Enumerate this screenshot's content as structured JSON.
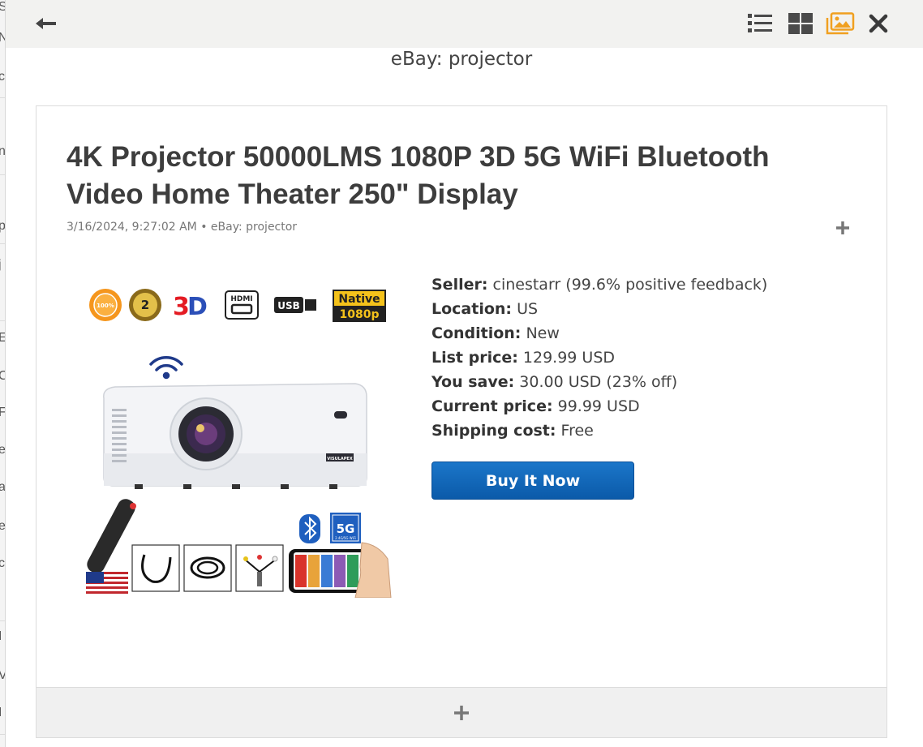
{
  "background": {
    "letters": [
      "S",
      "N",
      "c",
      "",
      "n",
      "",
      "p",
      "j",
      "E",
      "C",
      "F",
      "e",
      "a",
      "e",
      "c",
      "I",
      "V",
      "I"
    ]
  },
  "toolbar": {
    "back_icon": "arrow-left-icon",
    "list_view_icon": "list-view-icon",
    "grid_view_icon": "grid-view-icon",
    "image_view_icon": "image-view-icon",
    "close_icon": "close-icon",
    "active_color": "#f0a020",
    "icon_color": "#444444"
  },
  "feed_title": "eBay: projector",
  "item": {
    "title": "4K Projector 50000LMS 1080P 3D 5G WiFi Bluetooth Video Home Theater 250\" Display",
    "meta": "3/16/2024, 9:27:02 AM • eBay: projector",
    "image": {
      "badges": [
        "GUARANTEED QUALITY 100%",
        "2 YEAR WARRANTY",
        "3D",
        "HDMI",
        "USB",
        "Native 1080p"
      ],
      "brand": "VISULAPEX",
      "phone_badge": "5G",
      "phone_badge_sub": "2.4G/5G WiFi"
    },
    "details": [
      {
        "label": "Seller:",
        "value": "cinestarr (99.6% positive feedback)"
      },
      {
        "label": "Location:",
        "value": "US"
      },
      {
        "label": "Condition:",
        "value": "New"
      },
      {
        "label": "List price:",
        "value": "129.99 USD"
      },
      {
        "label": "You save:",
        "value": "30.00 USD (23% off)"
      },
      {
        "label": "Current price:",
        "value": "99.99 USD"
      },
      {
        "label": "Shipping cost:",
        "value": "Free"
      }
    ],
    "buy_button": "Buy It Now",
    "expand_icon": "plus-icon",
    "footer_icon": "plus-icon"
  }
}
